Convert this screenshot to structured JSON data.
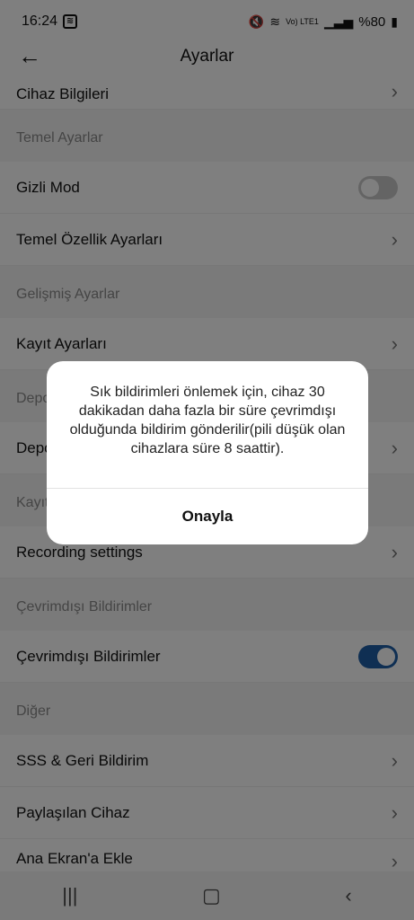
{
  "status": {
    "time": "16:24",
    "battery": "%80",
    "network": "Vo) LTE1"
  },
  "header": {
    "title": "Ayarlar"
  },
  "rows": {
    "cihaz_bilgileri": "Cihaz Bilgileri",
    "gizli_mod": "Gizli Mod",
    "temel_ozellik": "Temel Özellik Ayarları",
    "kayit_ayarlari": "Kayıt Ayarları",
    "depo_row": "Depo",
    "recording": "Recording settings",
    "cevrimdisi": "Çevrimdışı Bildirimler",
    "sss": "SSS & Geri Bildirim",
    "paylasilan": "Paylaşılan Cihaz",
    "ana_ekran": "Ana Ekran'a Ekle"
  },
  "sections": {
    "temel": "Temel Ayarlar",
    "gelismis": "Gelişmiş Ayarlar",
    "depo": "Depo",
    "kayit": "Kayıt",
    "cevrimdisi": "Çevrimdışı Bildirimler",
    "diger": "Diğer"
  },
  "toggles": {
    "gizli_mod": false,
    "cevrimdisi": true
  },
  "dialog": {
    "message": "Sık bildirimleri önlemek için, cihaz 30 dakikadan daha fazla bir süre çevrimdışı olduğunda bildirim gönderilir(pili düşük olan cihazlara süre 8 saattir).",
    "confirm": "Onayla"
  },
  "icons": {
    "back": "back-arrow-icon",
    "chevron": "chevron-right-icon",
    "recents": "recents-icon",
    "home": "home-icon",
    "navback": "nav-back-icon"
  }
}
